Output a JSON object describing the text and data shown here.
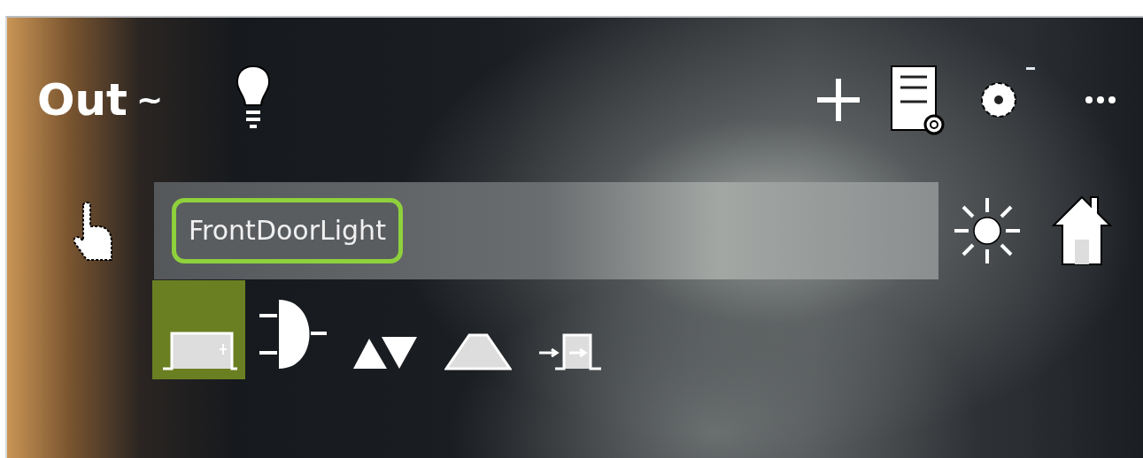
{
  "header": {
    "title": "Out",
    "wave_symbol": "~"
  },
  "block": {
    "name": "FrontDoorLight"
  },
  "tools": [
    {
      "kind": "pulse",
      "selected": true
    },
    {
      "kind": "gate",
      "selected": false
    },
    {
      "kind": "updown",
      "selected": false
    },
    {
      "kind": "ramp",
      "selected": false
    },
    {
      "kind": "delay",
      "selected": false
    }
  ]
}
